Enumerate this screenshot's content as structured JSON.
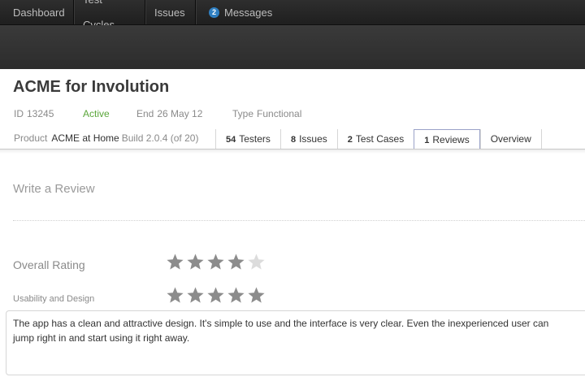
{
  "nav": {
    "items": [
      {
        "label": "Dashboard"
      },
      {
        "label": "Test Cycles"
      },
      {
        "label": "Issues"
      },
      {
        "label": "Messages",
        "badge": "2"
      }
    ]
  },
  "cycle": {
    "title": "ACME for Involution",
    "id_label": "ID",
    "id_value": "13245",
    "status": "Active",
    "end_label": "End",
    "end_value": "26 May 12",
    "type_label": "Type",
    "type_value": "Functional",
    "product_label": "Product",
    "product_name": "ACME at Home",
    "build": "Build 2.0.4 (of 20)"
  },
  "tabs": [
    {
      "count": "54",
      "label": "Testers"
    },
    {
      "count": "8",
      "label": "Issues"
    },
    {
      "count": "2",
      "label": "Test Cases"
    },
    {
      "count": "1",
      "label": "Reviews",
      "active": true
    },
    {
      "count": "",
      "label": "Overview"
    }
  ],
  "review": {
    "section_title": "Write a Review",
    "overall_label": "Overall Rating",
    "overall_rating": 4,
    "usability_label": "Usability and Design",
    "usability_rating": 5,
    "max_rating": 5,
    "text": "The app has a clean and attractive design. It's simple to use and the interface is very clear. Even the inexperienced user can jump right in and start using it right away."
  },
  "colors": {
    "star_filled": "#8c8c8c",
    "star_empty": "#dcdcdc",
    "status_active": "#5aa63a",
    "badge": "#2f7fc1"
  }
}
